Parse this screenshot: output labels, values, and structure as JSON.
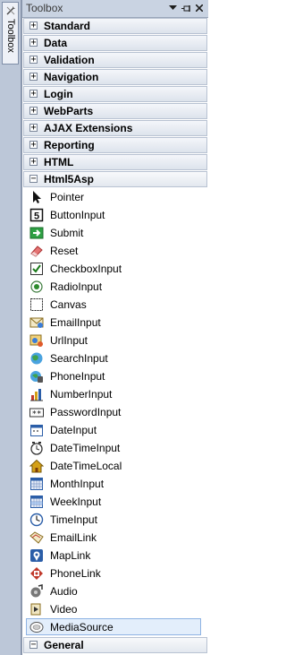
{
  "strip": {
    "label": "Toolbox"
  },
  "header": {
    "title": "Toolbox"
  },
  "categories_top": [
    {
      "label": "Standard"
    },
    {
      "label": "Data"
    },
    {
      "label": "Validation"
    },
    {
      "label": "Navigation"
    },
    {
      "label": "Login"
    },
    {
      "label": "WebParts"
    },
    {
      "label": "AJAX Extensions"
    },
    {
      "label": "Reporting"
    },
    {
      "label": "HTML"
    }
  ],
  "open_category": {
    "label": "Html5Asp"
  },
  "items": [
    {
      "label": "Pointer",
      "icon": "pointer-icon"
    },
    {
      "label": "ButtonInput",
      "icon": "button-input-icon"
    },
    {
      "label": "Submit",
      "icon": "submit-icon"
    },
    {
      "label": "Reset",
      "icon": "reset-icon"
    },
    {
      "label": "CheckboxInput",
      "icon": "checkbox-icon"
    },
    {
      "label": "RadioInput",
      "icon": "radio-icon"
    },
    {
      "label": "Canvas",
      "icon": "canvas-icon"
    },
    {
      "label": "EmailInput",
      "icon": "email-icon"
    },
    {
      "label": "UrlInput",
      "icon": "url-icon"
    },
    {
      "label": "SearchInput",
      "icon": "search-icon"
    },
    {
      "label": "PhoneInput",
      "icon": "phone-icon"
    },
    {
      "label": "NumberInput",
      "icon": "number-icon"
    },
    {
      "label": "PasswordInput",
      "icon": "password-icon"
    },
    {
      "label": "DateInput",
      "icon": "date-icon"
    },
    {
      "label": "DateTimeInput",
      "icon": "datetime-icon"
    },
    {
      "label": "DateTimeLocal",
      "icon": "datetime-local-icon"
    },
    {
      "label": "MonthInput",
      "icon": "month-icon"
    },
    {
      "label": "WeekInput",
      "icon": "week-icon"
    },
    {
      "label": "TimeInput",
      "icon": "time-icon"
    },
    {
      "label": "EmailLink",
      "icon": "email-link-icon"
    },
    {
      "label": "MapLink",
      "icon": "map-link-icon"
    },
    {
      "label": "PhoneLink",
      "icon": "phone-link-icon"
    },
    {
      "label": "Audio",
      "icon": "audio-icon"
    },
    {
      "label": "Video",
      "icon": "video-icon"
    },
    {
      "label": "MediaSource",
      "icon": "media-source-icon",
      "selected": true
    }
  ],
  "categories_bottom": [
    {
      "label": "General"
    }
  ]
}
